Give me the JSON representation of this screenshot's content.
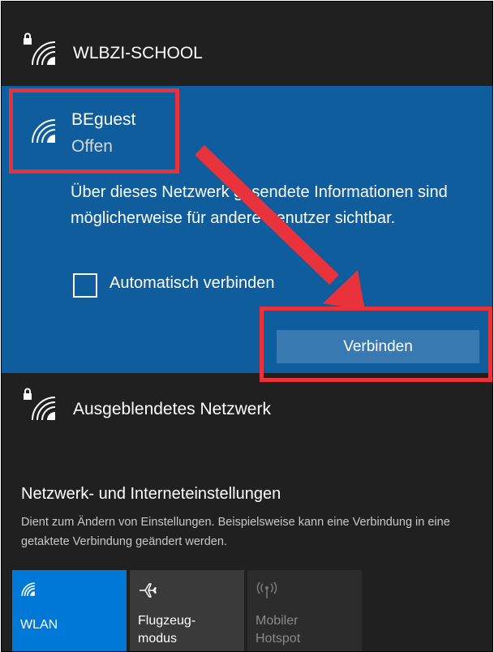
{
  "networks": {
    "top": {
      "name": "WLBZI-SCHOOL"
    },
    "selected": {
      "name": "BEguest",
      "status": "Offen",
      "warning": "Über dieses Netzwerk gesendete Informationen sind möglicherweise für andere Benutzer sichtbar.",
      "auto_connect_label": "Automatisch verbinden",
      "auto_connect_checked": false,
      "connect_label": "Verbinden"
    },
    "hidden": {
      "name": "Ausgeblendetes Netzwerk"
    }
  },
  "settings": {
    "title": "Netzwerk- und Interneteinstellungen",
    "description": "Dient zum Ändern von Einstellungen. Beispielsweise kann eine Verbindung in eine getaktete Verbindung geändert werden."
  },
  "quick_actions": [
    {
      "label_line1": "WLAN",
      "label_line2": "",
      "icon": "wifi-icon",
      "active": true
    },
    {
      "label_line1": "Flugzeug-",
      "label_line2": "modus",
      "icon": "airplane-icon",
      "active": false
    },
    {
      "label_line1": "Mobiler",
      "label_line2": "Hotspot",
      "icon": "hotspot-icon",
      "active": false,
      "disabled": true
    }
  ],
  "colors": {
    "panel_bg": "#202020",
    "selected_bg": "#0f5d9d",
    "button_bg": "#3879b1",
    "accent": "#0078d7",
    "annotation_red": "#e8323c"
  }
}
